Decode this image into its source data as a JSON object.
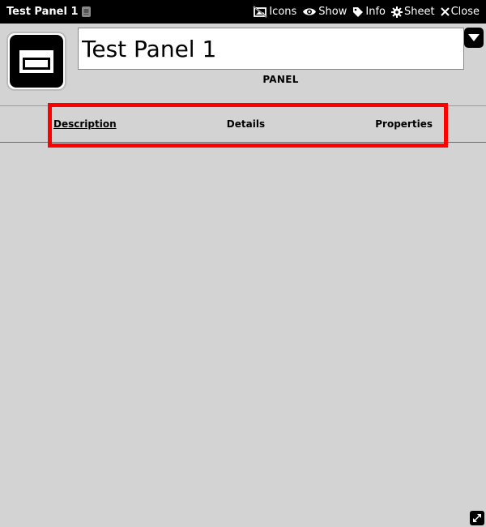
{
  "window": {
    "title": "Test Panel 1",
    "controls": [
      {
        "label": "Icons",
        "icon": "no-image-icon"
      },
      {
        "label": "Show",
        "icon": "eye-icon"
      },
      {
        "label": "Info",
        "icon": "tag-icon"
      },
      {
        "label": "Sheet",
        "icon": "gear-icon"
      },
      {
        "label": "Close",
        "icon": "close-icon"
      }
    ]
  },
  "header": {
    "name_value": "Test Panel 1",
    "sheet_type": "PANEL"
  },
  "tabs": [
    {
      "label": "Description",
      "active": true
    },
    {
      "label": "Details",
      "active": false
    },
    {
      "label": "Properties",
      "active": false
    }
  ],
  "colors": {
    "background": "#d3d3d3",
    "titlebar": "#000000",
    "highlight": "#ff0000"
  }
}
